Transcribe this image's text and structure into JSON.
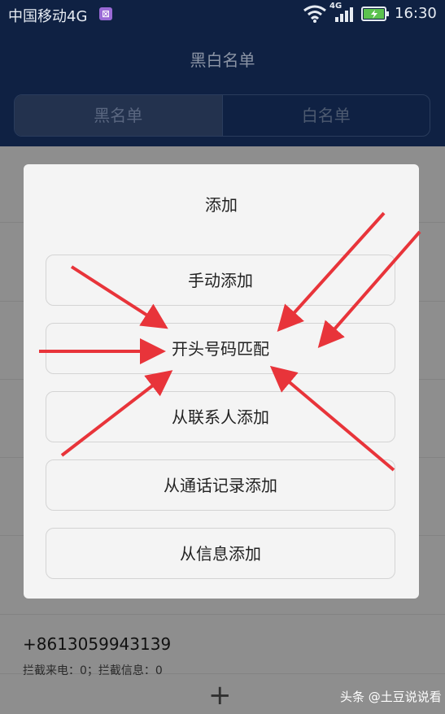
{
  "statusbar": {
    "carrier": "中国移动4G",
    "net_label": "4G",
    "time": "16:30"
  },
  "header": {
    "title": "黑白名单",
    "tabs": [
      {
        "label": "黑名单",
        "active": true
      },
      {
        "label": "白名单",
        "active": false
      }
    ]
  },
  "list": {
    "entry_number": "+8613059943139",
    "entry_stats": "拦截来电：0；拦截信息：0",
    "add_symbol": "+"
  },
  "dialog": {
    "title": "添加",
    "options": [
      {
        "label": "手动添加"
      },
      {
        "label": "开头号码匹配"
      },
      {
        "label": "从联系人添加"
      },
      {
        "label": "从通话记录添加"
      },
      {
        "label": "从信息添加"
      }
    ]
  },
  "watermark": "头条 @土豆说说看",
  "annotation": {
    "arrow_color": "#e8343a",
    "arrow_target": "开头号码匹配"
  }
}
